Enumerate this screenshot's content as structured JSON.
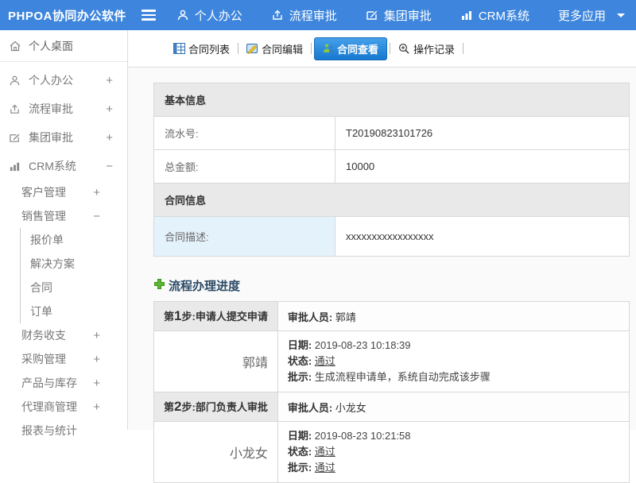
{
  "app": {
    "title": "PHPOA协同办公软件"
  },
  "topnav": {
    "items": [
      {
        "label": "个人办公"
      },
      {
        "label": "流程审批"
      },
      {
        "label": "集团审批"
      },
      {
        "label": "CRM系统"
      },
      {
        "label": "更多应用"
      }
    ]
  },
  "sidebar": {
    "items": [
      {
        "label": "个人桌面",
        "toggle": ""
      },
      {
        "label": "个人办公",
        "toggle": "+"
      },
      {
        "label": "流程审批",
        "toggle": "+"
      },
      {
        "label": "集团审批",
        "toggle": "+"
      },
      {
        "label": "CRM系统",
        "toggle": "−"
      },
      {
        "label": "客户管理",
        "toggle": "+"
      },
      {
        "label": "销售管理",
        "toggle": "−"
      },
      {
        "label": "报价单",
        "toggle": ""
      },
      {
        "label": "解决方案",
        "toggle": ""
      },
      {
        "label": "合同",
        "toggle": ""
      },
      {
        "label": "订单",
        "toggle": ""
      },
      {
        "label": "财务收支",
        "toggle": "+"
      },
      {
        "label": "采购管理",
        "toggle": "+"
      },
      {
        "label": "产品与库存",
        "toggle": "+"
      },
      {
        "label": "代理商管理",
        "toggle": "+"
      },
      {
        "label": "报表与统计",
        "toggle": ""
      }
    ]
  },
  "tabs": {
    "items": [
      {
        "label": "合同列表",
        "active": false
      },
      {
        "label": "合同编辑",
        "active": false
      },
      {
        "label": "合同查看",
        "active": true
      },
      {
        "label": "操作记录",
        "active": false
      }
    ]
  },
  "info": {
    "sections": [
      {
        "title": "基本信息",
        "rows": [
          {
            "label": "流水号:",
            "value": "T20190823101726"
          },
          {
            "label": "总金额:",
            "value": "10000"
          }
        ]
      },
      {
        "title": "合同信息",
        "rows": [
          {
            "label": "合同描述:",
            "value": "xxxxxxxxxxxxxxxxx"
          }
        ]
      }
    ]
  },
  "process": {
    "title": "流程办理进度",
    "steps": [
      {
        "step_prefix": "第",
        "step_num": "1",
        "step_suffix": "步:申请人提交申请",
        "approver_label": "审批人员:",
        "approver": "郭靖",
        "name": "郭靖",
        "lines": [
          {
            "label": "日期:",
            "value": "2019-08-23 10:18:39"
          },
          {
            "label": "状态:",
            "value": "通过"
          },
          {
            "label": "批示:",
            "value": "生成流程申请单，系统自动完成该步骤"
          }
        ]
      },
      {
        "step_prefix": "第",
        "step_num": "2",
        "step_suffix": "步:部门负责人审批",
        "approver_label": "审批人员:",
        "approver": "小龙女",
        "name": "小龙女",
        "lines": [
          {
            "label": "日期:",
            "value": "2019-08-23 10:21:58"
          },
          {
            "label": "状态:",
            "value": "通过"
          },
          {
            "label": "批示:",
            "value": "通过"
          }
        ]
      }
    ]
  },
  "colors": {
    "topbar_blue": "#3e86dd",
    "active_tab_blue": "#1678d0",
    "section_header_gray": "#e9e9e9",
    "highlight_cell_blue": "#e4f2fb",
    "plus_icon_green": "#5cb832"
  }
}
